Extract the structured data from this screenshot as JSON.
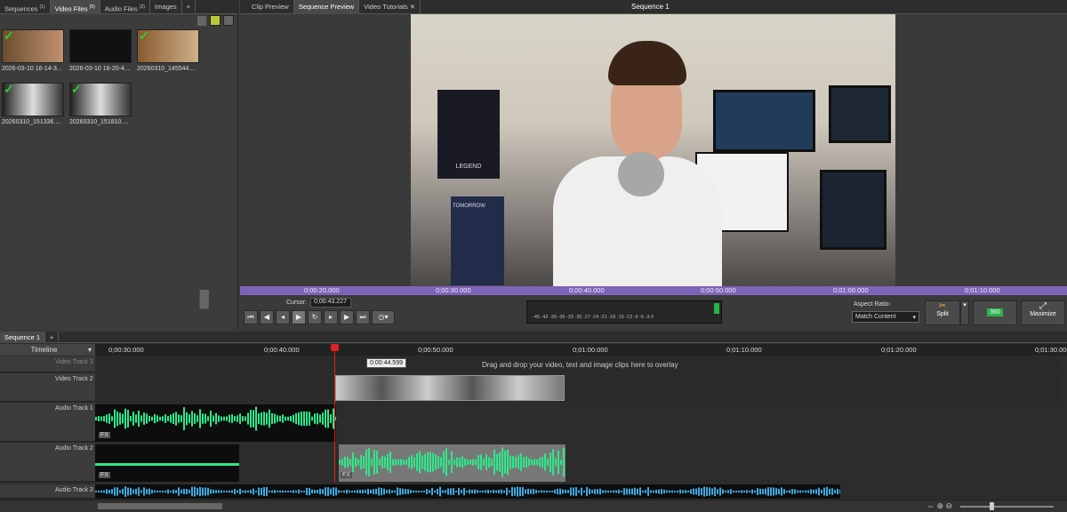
{
  "bin": {
    "tabs": [
      {
        "label": "Sequences",
        "count": "(1)"
      },
      {
        "label": "Video Files",
        "count": "(5)"
      },
      {
        "label": "Audio Files",
        "count": "(2)"
      },
      {
        "label": "Images",
        "count": ""
      },
      {
        "label": "+",
        "count": ""
      }
    ],
    "items": [
      {
        "label": "2026-03-10 16-14-3..."
      },
      {
        "label": "2026-03-10 16-20-4..."
      },
      {
        "label": "20260310_145544...."
      },
      {
        "label": "20260310_151336...."
      },
      {
        "label": "20260310_151810...."
      }
    ]
  },
  "preview": {
    "tabs": [
      "Clip Preview",
      "Sequence Preview",
      "Video Tutorials"
    ],
    "title": "Sequence 1",
    "ruler": [
      "0;00:20.000",
      "0;00:30.000",
      "0;00:40.000",
      "0;00:50.000",
      "0;01:00.000",
      "0;01:10.000"
    ],
    "cursor_label": "Cursor:",
    "cursor_value": "0;00:43.227",
    "meter_labels": "-45 -42 -39 -36 -33 -30 -27 -24 -21 -18 -15 -12 -9 -6 -3 0",
    "aspect_label": "Aspect Ratio:",
    "aspect_value": "Match Content",
    "split_label": "Split",
    "label_360": "360",
    "maximize_label": "Maximize",
    "poster_text": "LEGEND",
    "poster_text2": "TOMORROW"
  },
  "timeline": {
    "tab": "Sequence 1",
    "header": "Timeline",
    "ruler": [
      "0;00:30.000",
      "0;00:40.000",
      "0;00:50.000",
      "0;01:00.000",
      "0;01:10.000",
      "0;01:20.000",
      "0;01:30.000"
    ],
    "tooltip": "0:00:44.599",
    "overlay_hint": "Drag and drop your video, text and image clips here to overlay",
    "tracks": [
      "Video Track 3",
      "Video Track 2",
      "Audio Track 1",
      "Audio Track 2",
      "Audio Track 3"
    ],
    "fx": "FX"
  },
  "colors": {
    "accent": "#7f63b8",
    "wave": "#2ee88a",
    "wave_blue": "#3fa9e0",
    "check": "#27d327",
    "playhead": "#e02020"
  }
}
